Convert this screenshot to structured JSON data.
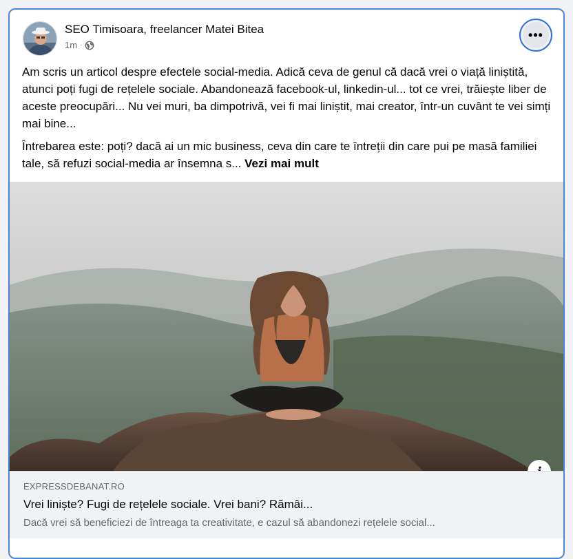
{
  "post": {
    "author": "SEO Timisoara, freelancer Matei Bitea",
    "time": "1m",
    "separator": "·",
    "privacy_icon": "globe-icon",
    "more_icon": "more-options-icon",
    "more_label": "•••",
    "paragraphs": [
      "Am scris un articol despre efectele social-media. Adică ceva de genul că dacă vrei o viață liniștită, atunci poți fugi de rețelele sociale. Abandonează facebook-ul, linkedin-ul... tot ce vrei, trăiește liber de aceste preocupări... Nu vei muri, ba dimpotrivă, vei fi mai liniștit, mai creator, într-un cuvânt te vei simți mai bine...",
      "Întrebarea este: poți? dacă ai un mic business, ceva din care te întreții din care pui pe masă familiei tale, să refuzi social-media ar însemna s..."
    ],
    "see_more": "Vezi mai mult"
  },
  "link_preview": {
    "domain": "EXPRESSDEBANAT.RO",
    "title": "Vrei liniște? Fugi de rețelele sociale. Vrei bani? Rămâi...",
    "description": "Dacă vrei să beneficiezi de întreaga ta creativitate, e cazul să abandonezi rețelele social...",
    "info_icon": "info-icon",
    "info_label": "i"
  },
  "colors": {
    "border_accent": "#4a86d8",
    "secondary_text": "#65676b",
    "preview_bg": "#f0f2f5"
  }
}
